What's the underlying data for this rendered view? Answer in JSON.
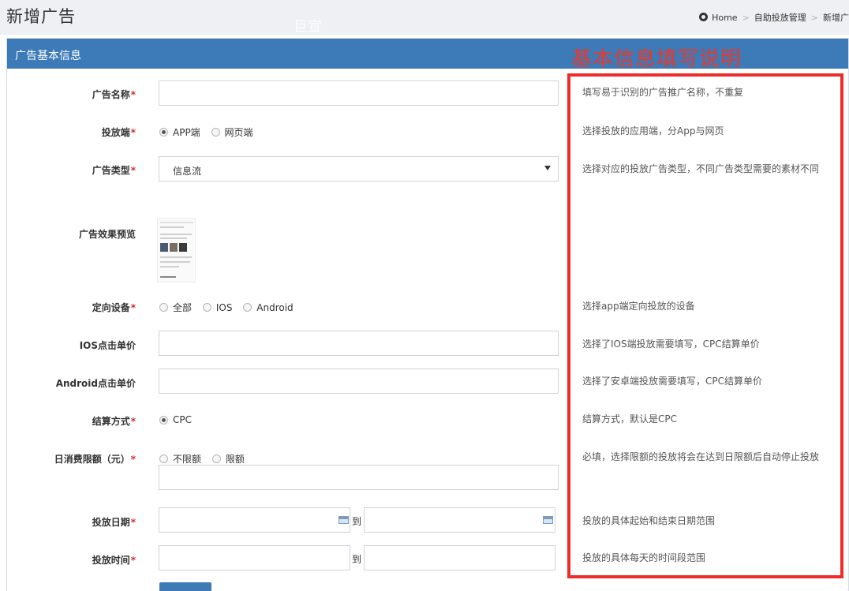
{
  "header": {
    "title": "新增广告",
    "watermark": "巨宣",
    "breadcrumb": [
      "Home",
      "自助投放管理",
      "新增广"
    ]
  },
  "panel": {
    "heading": "广告基本信息",
    "overlay_title": "基本信息填写说明"
  },
  "form": {
    "required_mark": "*",
    "ad_name_label": "广告名称",
    "channel_label": "投放端",
    "channel_options": [
      "APP端",
      "网页端"
    ],
    "channel_selected": "APP端",
    "ad_type_label": "广告类型",
    "ad_type_value": "信息流",
    "preview_label": "广告效果预览",
    "device_label": "定向设备",
    "device_options": [
      "全部",
      "IOS",
      "Android"
    ],
    "ios_price_label": "IOS点击单价",
    "android_price_label": "Android点击单价",
    "settlement_label": "结算方式",
    "settlement_options": [
      "CPC"
    ],
    "settlement_selected": "CPC",
    "daily_limit_label": "日消费限额（元）",
    "daily_limit_options": [
      "不限额",
      "限额"
    ],
    "date_label": "投放日期",
    "time_label": "投放时间",
    "range_to": "到"
  },
  "help": {
    "ad_name": "填写易于识别的广告推广名称，不重复",
    "channel": "选择投放的应用端，分App与网页",
    "ad_type": "选择对应的投放广告类型，不同广告类型需要的素材不同",
    "device": "选择app端定向投放的设备",
    "ios_price": "选择了IOS端投放需要填写，CPC结算单价",
    "android_price": "选择了安卓端投放需要填写，CPC结算单价",
    "settlement": "结算方式，默认是CPC",
    "daily_limit": "必填，选择限额的投放将会在达到日限额后自动停止投放",
    "date": "投放的具体起始和结束日期范围",
    "time": "投放的具体每天的时间段范围"
  },
  "colors": {
    "header_blue": "#3c7ab8",
    "annotation_red": "#ee2d2a",
    "required_red": "#d9272e"
  },
  "icons": [
    "dashboard-icon",
    "calendar-icon",
    "dropdown-arrow-icon"
  ]
}
